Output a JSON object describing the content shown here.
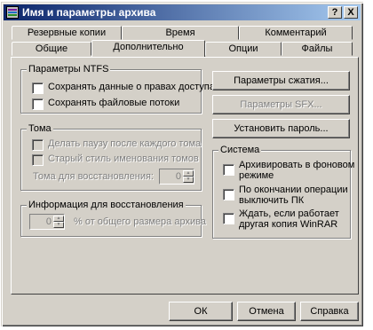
{
  "window": {
    "title": "Имя и параметры архива"
  },
  "title_buttons": {
    "help": "?",
    "close": "X"
  },
  "tabs": {
    "row_back": [
      "Резервные копии",
      "Время",
      "Комментарий"
    ],
    "row_front": [
      "Общие",
      "Дополнительно",
      "Опции",
      "Файлы"
    ],
    "active": "Дополнительно"
  },
  "ntfs": {
    "legend": "Параметры NTFS",
    "save_access": {
      "label": "Сохранять данные о правах доступа",
      "checked": false
    },
    "save_streams": {
      "label": "Сохранять файловые потоки",
      "checked": false
    }
  },
  "volumes": {
    "legend": "Тома",
    "pause": {
      "label": "Делать паузу после каждого тома",
      "checked": false,
      "disabled": true
    },
    "old_naming": {
      "label": "Старый стиль именования томов",
      "checked": false,
      "disabled": true
    },
    "recovery_label": "Тома для восстановления:",
    "recovery_value": "0"
  },
  "recovery": {
    "legend": "Информация для восстановления",
    "value": "0",
    "suffix": "% от общего размера архива"
  },
  "buttons": {
    "compression": "Параметры сжатия...",
    "sfx": "Параметры SFX...",
    "password": "Установить пароль..."
  },
  "system": {
    "legend": "Система",
    "background": {
      "label_line1": "Архивировать в фоновом",
      "label_line2": "режиме",
      "checked": false
    },
    "shutdown": {
      "label_line1": "По окончании операции",
      "label_line2": "выключить ПК",
      "checked": false
    },
    "wait": {
      "label_line1": "Ждать, если работает",
      "label_line2": "другая копия WinRAR",
      "checked": false
    }
  },
  "dialog": {
    "ok": "ОК",
    "cancel": "Отмена",
    "help": "Справка"
  }
}
